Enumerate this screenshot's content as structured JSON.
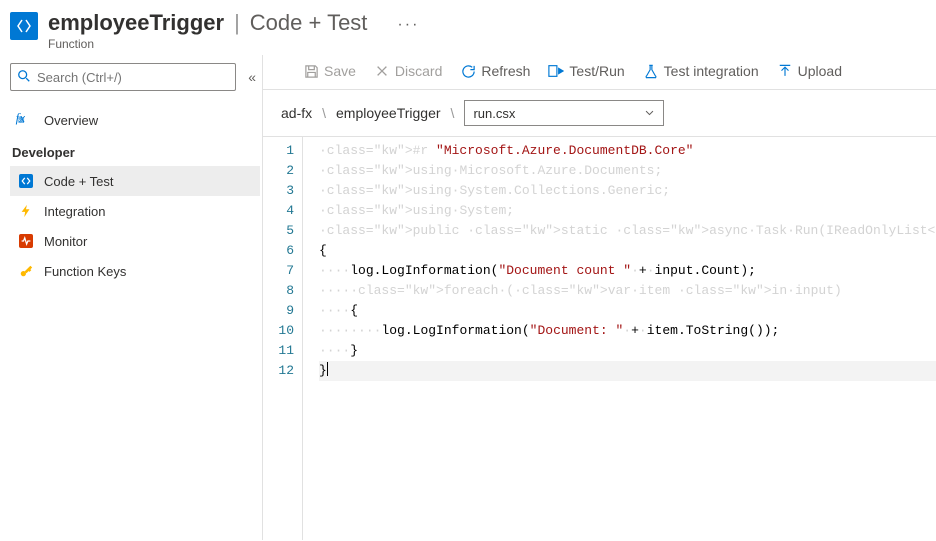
{
  "header": {
    "title": "employeeTrigger",
    "subtitle": "Code + Test",
    "category": "Function"
  },
  "search": {
    "placeholder": "Search (Ctrl+/)"
  },
  "sidebar": {
    "overview": "Overview",
    "dev_header": "Developer",
    "items": [
      {
        "label": "Code + Test",
        "key": "code-test"
      },
      {
        "label": "Integration",
        "key": "integration"
      },
      {
        "label": "Monitor",
        "key": "monitor"
      },
      {
        "label": "Function Keys",
        "key": "function-keys"
      }
    ]
  },
  "toolbar": {
    "save": "Save",
    "discard": "Discard",
    "refresh": "Refresh",
    "testrun": "Test/Run",
    "testint": "Test integration",
    "upload": "Upload"
  },
  "breadcrumb": {
    "app": "ad-fx",
    "func": "employeeTrigger",
    "file": "run.csx"
  },
  "code": {
    "lines": [
      "#r \"Microsoft.Azure.DocumentDB.Core\"",
      "using Microsoft.Azure.Documents;",
      "using System.Collections.Generic;",
      "using System;",
      "public static async Task Run(IReadOnlyList<Document> input, ILogger log)",
      "{",
      "    log.LogInformation(\"Document count \" + input.Count);",
      "    foreach (var item in input)",
      "    {",
      "        log.LogInformation(\"Document: \" + item.ToString());",
      "    }",
      "}"
    ],
    "line_count": 12
  }
}
